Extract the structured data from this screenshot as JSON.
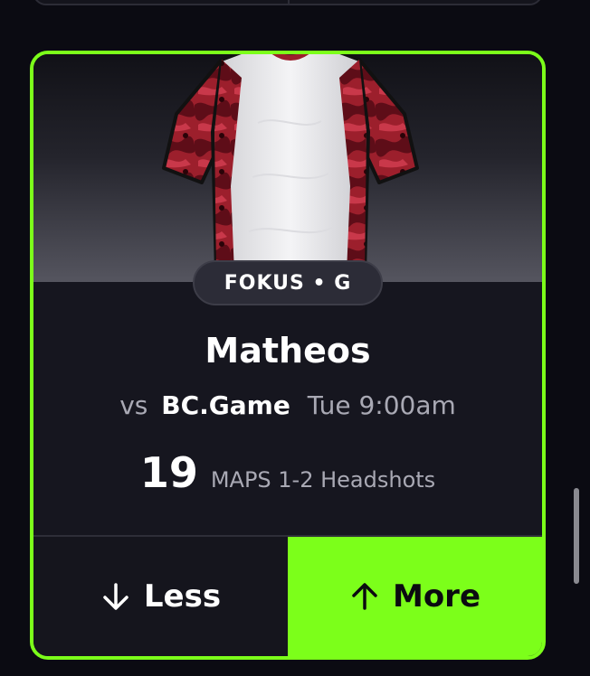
{
  "card": {
    "team_position": "FOKUS • G",
    "player_name": "Matheos",
    "vs_label": "vs",
    "opponent": "BC.Game",
    "game_time": "Tue 9:00am",
    "line_value": "19",
    "stat_label": "MAPS 1-2 Headshots",
    "jersey_icon": "jersey-icon"
  },
  "actions": {
    "less_label": "Less",
    "more_label": "More",
    "less_icon": "arrow-down-icon",
    "more_icon": "arrow-up-icon"
  },
  "colors": {
    "accent": "#7cff1a",
    "background": "#0b0b12",
    "card": "#16161f",
    "muted_text": "#a9a9b4"
  }
}
